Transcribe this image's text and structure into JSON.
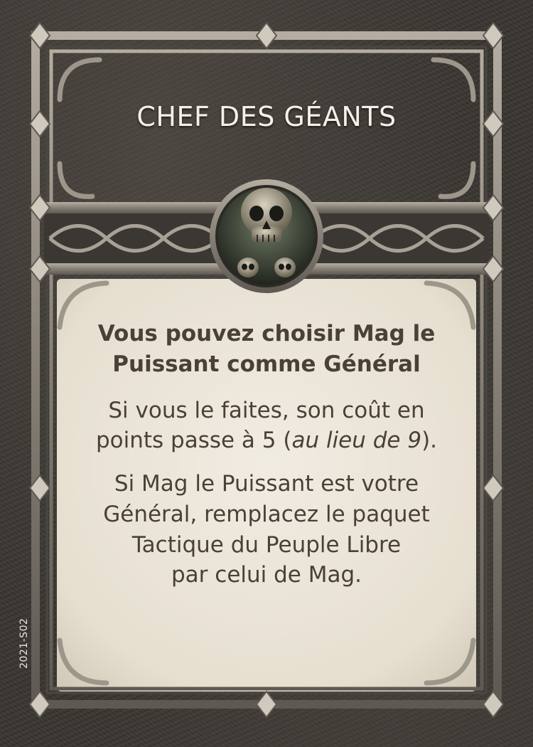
{
  "card": {
    "title": "CHEF DES GÉANTS",
    "rule_bold_line1": "Vous pouvez choisir Mag le",
    "rule_bold_line2": "Puissant comme Général",
    "rule2_line1": "Si vous le faites, son coût en",
    "rule2_line2_pre": "points passe à 5 (",
    "rule2_line2_italic": "au lieu de 9",
    "rule2_line2_post": ").",
    "rule3_line1": "Si Mag le Puissant est votre",
    "rule3_line2": "Général, remplacez le paquet",
    "rule3_line3": "Tactique du Peuple Libre",
    "rule3_line4": "par celui de Mag.",
    "card_code": "2021-S02"
  },
  "colors": {
    "frame_metal": "#8a847a",
    "frame_dark": "#3c3833",
    "parchment": "#ece6d9",
    "rule_text": "#4a4036",
    "title_text": "#f4f0ea"
  },
  "icons": {
    "emblem": "skull-emblem-icon"
  }
}
